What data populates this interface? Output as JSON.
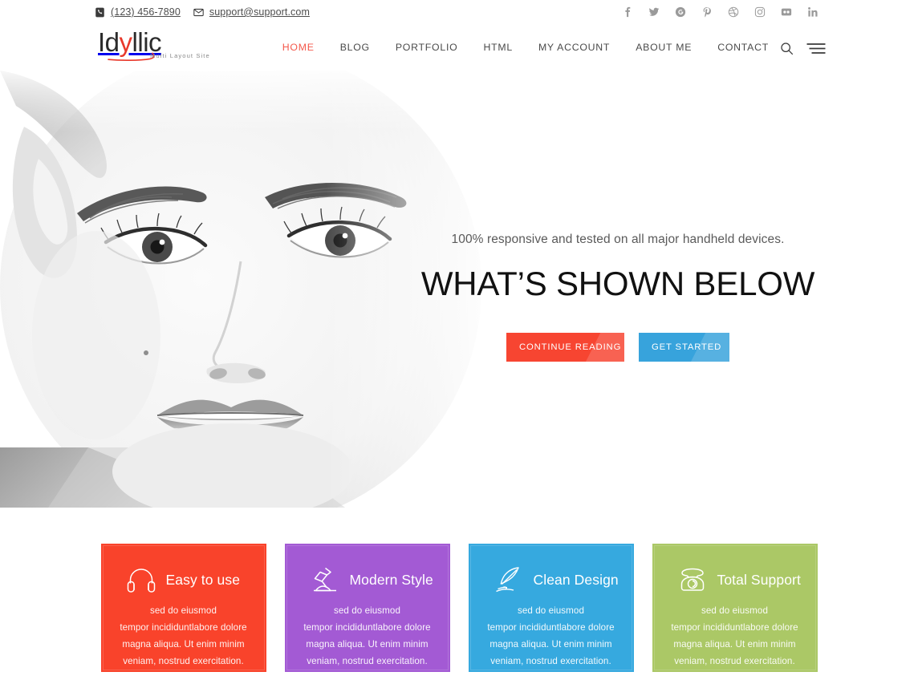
{
  "topbar": {
    "phone": "(123) 456-7890",
    "email": "support@support.com",
    "phone_icon": "phone-icon",
    "email_icon": "envelope-icon",
    "socials": [
      {
        "name": "facebook",
        "label": "f"
      },
      {
        "name": "twitter",
        "label": "t"
      },
      {
        "name": "google-plus",
        "label": "g+"
      },
      {
        "name": "pinterest",
        "label": "p"
      },
      {
        "name": "dribbble",
        "label": "d"
      },
      {
        "name": "instagram",
        "label": "ig"
      },
      {
        "name": "flickr",
        "label": "fl"
      },
      {
        "name": "linkedin",
        "label": "in"
      }
    ]
  },
  "header": {
    "logo": {
      "text_before": "Id",
      "accent_letter": "y",
      "text_after": "llic",
      "tagline": "Multi Layout Site",
      "accent_color": "#e8382b"
    },
    "nav": [
      {
        "label": "HOME",
        "active": true
      },
      {
        "label": "BLOG",
        "active": false
      },
      {
        "label": "PORTFOLIO",
        "active": false
      },
      {
        "label": "HTML",
        "active": false
      },
      {
        "label": "MY ACCOUNT",
        "active": false
      },
      {
        "label": "ABOUT ME",
        "active": false
      },
      {
        "label": "CONTACT",
        "active": false
      }
    ],
    "active_color": "#f4594c",
    "search_icon": "search-icon",
    "menu_icon": "hamburger-menu-icon"
  },
  "hero": {
    "subtitle": "100% responsive and tested on all major handheld devices.",
    "title": "WHAT’S SHOWN BELOW",
    "buttons": [
      {
        "label": "CONTINUE READING",
        "color": "#f74531"
      },
      {
        "label": "GET STARTED",
        "color": "#37a3dc"
      }
    ],
    "image_alt": "black and white close-up portrait of a woman's face"
  },
  "features": [
    {
      "icon": "headphones-icon",
      "title": "Easy to use",
      "line1": "sed do eiusmod",
      "line2": "tempor incididuntlabore dolore",
      "line3": "magna aliqua. Ut enim minim",
      "line4": "veniam, nostrud exercitation.",
      "color": "#f9432b"
    },
    {
      "icon": "desk-lamp-icon",
      "title": "Modern Style",
      "line1": "sed do eiusmod",
      "line2": "tempor incididuntlabore dolore",
      "line3": "magna aliqua. Ut enim minim",
      "line4": "veniam, nostrud exercitation.",
      "color": "#a35ad4"
    },
    {
      "icon": "quill-pen-icon",
      "title": "Clean Design",
      "line1": "sed do eiusmod",
      "line2": "tempor incididuntlabore dolore",
      "line3": "magna aliqua. Ut enim minim",
      "line4": "veniam, nostrud exercitation.",
      "color": "#36a9df"
    },
    {
      "icon": "telephone-icon",
      "title": "Total Support",
      "line1": "sed do eiusmod",
      "line2": "tempor incididuntlabore dolore",
      "line3": "magna aliqua. Ut enim minim",
      "line4": "veniam, nostrud exercitation.",
      "color": "#abc866"
    }
  ]
}
